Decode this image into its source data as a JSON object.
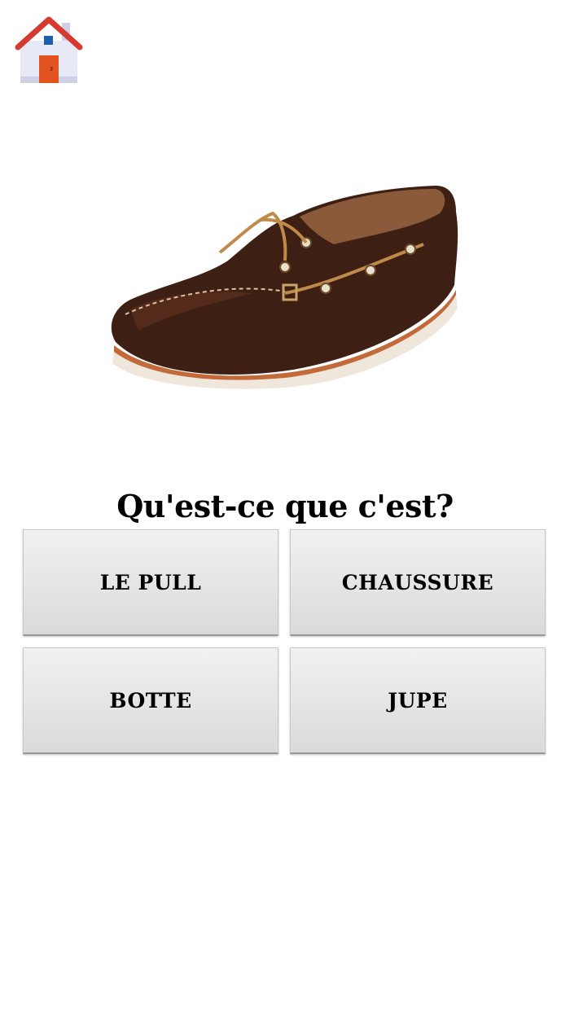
{
  "header": {
    "home_icon": "house-icon"
  },
  "illustration": {
    "subject": "shoe-image"
  },
  "quiz": {
    "question": "Qu'est-ce que c'est?",
    "answers": [
      {
        "label": "LE PULL"
      },
      {
        "label": "CHAUSSURE"
      },
      {
        "label": "BOTTE"
      },
      {
        "label": "JUPE"
      }
    ]
  },
  "colors": {
    "roof": "#d63a2e",
    "door": "#e2531f",
    "window": "#1d5fae",
    "wall": "#e8e9f6",
    "shoe_leather": "#3e1f14",
    "sole": "#efe7dc",
    "button_top": "#f1f1f1",
    "button_bottom": "#dadada"
  }
}
